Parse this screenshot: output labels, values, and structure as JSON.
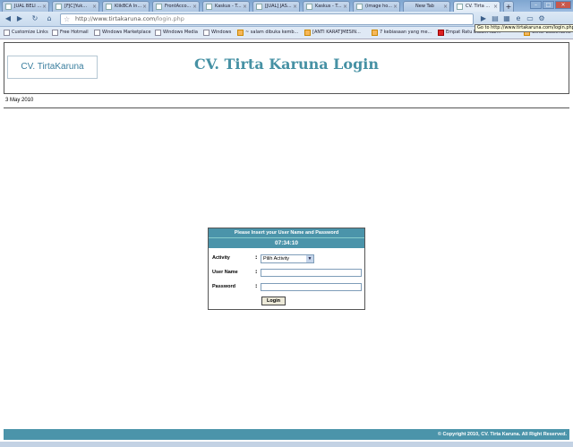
{
  "browser": {
    "tabs": [
      {
        "label": "JUAL BELI ..."
      },
      {
        "label": "[FJC]Yuk..."
      },
      {
        "label": "KlikBCA In..."
      },
      {
        "label": "FrontAcco..."
      },
      {
        "label": "Kaskus - T..."
      },
      {
        "label": "[JUAL] JAS..."
      },
      {
        "label": "Kaskus - T..."
      },
      {
        "label": "(image ho..."
      },
      {
        "label": "New Tab"
      },
      {
        "label": "CV. Tirta ..."
      }
    ],
    "url_prefix": "http://www.tirtakaruna.com/",
    "url_path": "login.php",
    "tooltip": "Go to http://www.tirtakaruna.com/login.php",
    "bookmarks": [
      {
        "label": "Customize Links"
      },
      {
        "label": "Free Hotmail"
      },
      {
        "label": "Windows Marketplace"
      },
      {
        "label": "Windows Media"
      },
      {
        "label": "Windows"
      },
      {
        "label": "~ salam dibuka kemb..."
      },
      {
        "label": "[ANTI KARAT]MESIN..."
      },
      {
        "label": "7 kebiasaan yang me..."
      },
      {
        "label": "Empat Ratu Dalam Kar..."
      },
      {
        "label": "Other bookmarks"
      }
    ]
  },
  "page": {
    "logo_text": "CV. TirtaKaruna",
    "title": "CV. Tirta Karuna Login",
    "date": "3 May 2010",
    "login": {
      "header": "Please Insert your User Name and Password",
      "clock": "07:34:10",
      "activity_label": "Activity",
      "activity_value": "Pilih Activity",
      "username_label": "User Name",
      "password_label": "Password",
      "colon": ":",
      "button_label": "Login"
    },
    "footer": "© Copyright 2010, CV. Tirta Karuna. All Right Reserved."
  }
}
